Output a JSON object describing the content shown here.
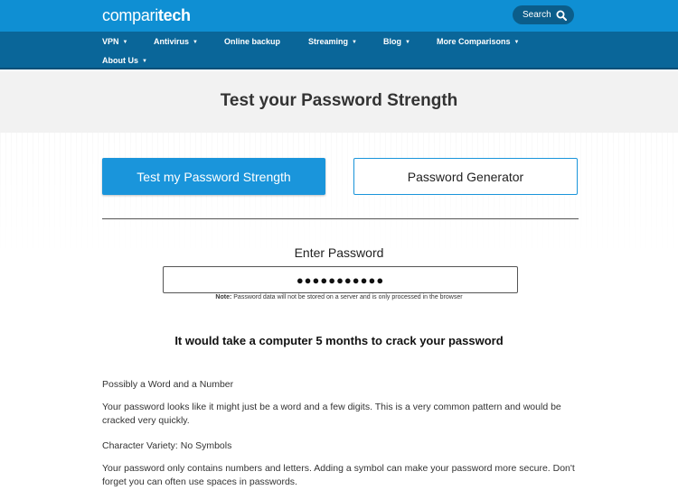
{
  "brand": {
    "logo_regular": "compari",
    "logo_bold": "tech"
  },
  "header": {
    "search_label": "Search"
  },
  "nav": {
    "items": [
      {
        "label": "VPN",
        "caret": "▼"
      },
      {
        "label": "Antivirus",
        "caret": "▼"
      },
      {
        "label": "Online backup",
        "caret": ""
      },
      {
        "label": "Streaming",
        "caret": "▼"
      },
      {
        "label": "Blog",
        "caret": "▼"
      },
      {
        "label": "More Comparisons",
        "caret": "▼"
      },
      {
        "label": "About Us",
        "caret": "▼"
      }
    ]
  },
  "hero": {
    "title": "Test your Password Strength"
  },
  "tabs": {
    "test_label": "Test my Password Strength",
    "generator_label": "Password Generator"
  },
  "form": {
    "label": "Enter Password",
    "value": "●●●●●●●●●●●",
    "note_prefix": "Note:",
    "note_text": " Password data will not be stored on a server and is only processed in the browser"
  },
  "result": {
    "text": "It would take a computer 5 months to crack your password"
  },
  "feedback": [
    {
      "heading": "Possibly a Word and a Number",
      "body": "Your password looks like it might just be a word and a few digits. This is a very common pattern and would be cracked very quickly."
    },
    {
      "heading": "Character Variety: No Symbols",
      "body": "Your password only contains numbers and letters. Adding a symbol can make your password more secure. Don't forget you can often use spaces in passwords."
    }
  ],
  "colors": {
    "topbar": "#0f8fd3",
    "navbar": "#0a6699",
    "accent": "#1a95db"
  }
}
